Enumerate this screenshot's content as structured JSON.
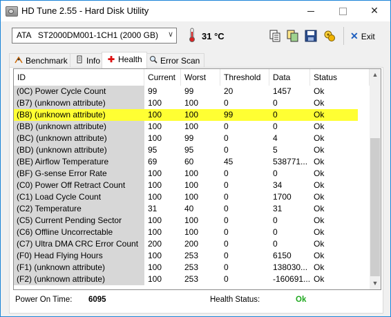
{
  "window": {
    "title": "HD Tune 2.55 - Hard Disk Utility",
    "minimize": "—",
    "close": "✕"
  },
  "toolbar": {
    "drive": "ATA   ST2000DM001-1CH1 (2000 GB)",
    "temperature": "31 °C",
    "exit_label": "Exit",
    "colors": {
      "accent": "#1e5fbf",
      "temp": "#d22"
    }
  },
  "tabs": [
    {
      "label": "Benchmark",
      "icon": "benchmark-icon"
    },
    {
      "label": "Info",
      "icon": "info-icon"
    },
    {
      "label": "Health",
      "icon": "health-cross-icon",
      "active": true
    },
    {
      "label": "Error Scan",
      "icon": "magnifier-icon"
    }
  ],
  "table": {
    "headers": [
      "ID",
      "Current",
      "Worst",
      "Threshold",
      "Data",
      "Status"
    ],
    "rows": [
      [
        "(0C) Power Cycle Count",
        "99",
        "99",
        "20",
        "1457",
        "Ok"
      ],
      [
        "(B7) (unknown attribute)",
        "100",
        "100",
        "0",
        "0",
        "Ok"
      ],
      [
        "(B8) (unknown attribute)",
        "100",
        "100",
        "99",
        "0",
        "Ok"
      ],
      [
        "(BB) (unknown attribute)",
        "100",
        "100",
        "0",
        "0",
        "Ok"
      ],
      [
        "(BC) (unknown attribute)",
        "100",
        "99",
        "0",
        "4",
        "Ok"
      ],
      [
        "(BD) (unknown attribute)",
        "95",
        "95",
        "0",
        "5",
        "Ok"
      ],
      [
        "(BE) Airflow Temperature",
        "69",
        "60",
        "45",
        "538771...",
        "Ok"
      ],
      [
        "(BF) G-sense Error Rate",
        "100",
        "100",
        "0",
        "0",
        "Ok"
      ],
      [
        "(C0) Power Off Retract Count",
        "100",
        "100",
        "0",
        "34",
        "Ok"
      ],
      [
        "(C1) Load Cycle Count",
        "100",
        "100",
        "0",
        "1700",
        "Ok"
      ],
      [
        "(C2) Temperature",
        "31",
        "40",
        "0",
        "31",
        "Ok"
      ],
      [
        "(C5) Current Pending Sector",
        "100",
        "100",
        "0",
        "0",
        "Ok"
      ],
      [
        "(C6) Offline Uncorrectable",
        "100",
        "100",
        "0",
        "0",
        "Ok"
      ],
      [
        "(C7) Ultra DMA CRC Error Count",
        "200",
        "200",
        "0",
        "0",
        "Ok"
      ],
      [
        "(F0) Head Flying Hours",
        "100",
        "253",
        "0",
        "6150",
        "Ok"
      ],
      [
        "(F1) (unknown attribute)",
        "100",
        "253",
        "0",
        "138030...",
        "Ok"
      ],
      [
        "(F2) (unknown attribute)",
        "100",
        "253",
        "0",
        "-160691...",
        "Ok"
      ]
    ],
    "highlighted_row": 2,
    "highlight_color": "#ffff33"
  },
  "footer": {
    "power_on_label": "Power On Time:",
    "power_on_value": "6095",
    "health_label": "Health Status:",
    "health_value": "Ok",
    "health_color": "#1fa81f"
  }
}
